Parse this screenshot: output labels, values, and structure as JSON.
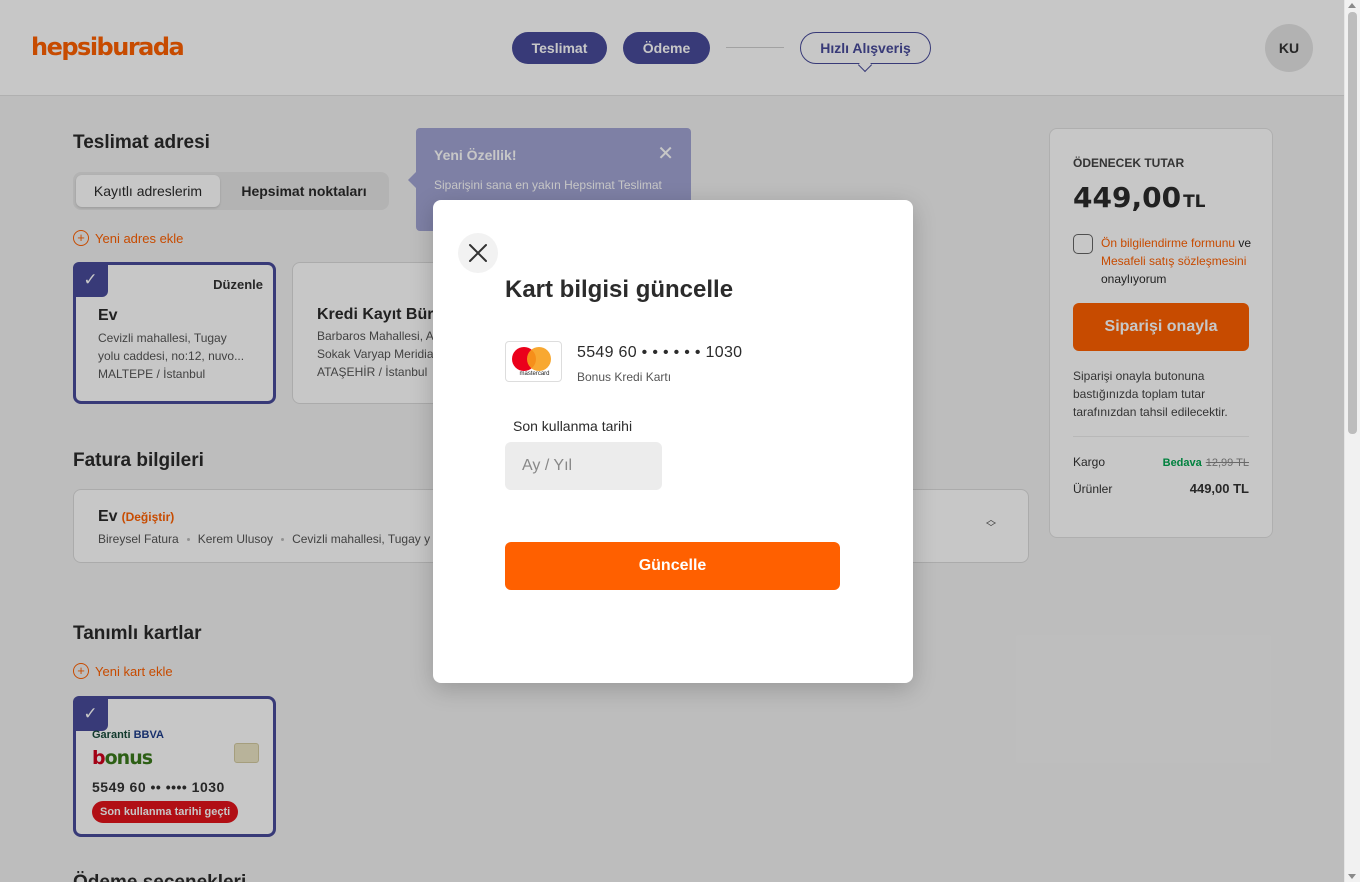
{
  "header": {
    "logo": "hepsiburada",
    "steps": [
      "Teslimat",
      "Ödeme",
      "Hızlı Alışveriş"
    ],
    "avatar_initials": "KU"
  },
  "delivery": {
    "title": "Teslimat adresi",
    "tabs": [
      "Kayıtlı adreslerim",
      "Hepsimat noktaları"
    ],
    "add_address": "Yeni adres ekle",
    "edit_label": "Düzenle",
    "addresses": [
      {
        "name": "Ev",
        "line1": "Cevizli mahallesi, Tugay",
        "line2": "yolu caddesi, no:12, nuvo...",
        "line3": "MALTEPE / İstanbul"
      },
      {
        "name": "Kredi Kayıt Büro",
        "line1": "Barbaros Mahallesi, A",
        "line2": "Sokak Varyap Meridia",
        "line3": "ATAŞEHİR / İstanbul"
      }
    ]
  },
  "tooltip": {
    "title": "Yeni Özellik!",
    "text": "Siparişini sana en yakın Hepsimat Teslimat noktasından teslim alabilirsin."
  },
  "billing": {
    "title": "Fatura bilgileri",
    "name": "Ev",
    "change": "(Değiştir)",
    "type": "Bireysel Fatura",
    "person": "Kerem Ulusoy",
    "address": "Cevizli mahallesi, Tugay y"
  },
  "cards": {
    "title": "Tanımlı kartlar",
    "add_card": "Yeni kart ekle",
    "bank_name": "Garanti",
    "bank_suffix": "BBVA",
    "brand": "bonus",
    "number": "5549 60 •• •••• 1030",
    "expired_badge": "Son kullanma tarihi geçti"
  },
  "bottom_title": "Ödeme seçenekleri",
  "summary": {
    "label": "ÖDENECEK TUTAR",
    "amount": "449,00",
    "currency": "TL",
    "link1": "Ön bilgilendirme formunu",
    "and": "ve",
    "link2": "Mesafeli satış sözleşmesini",
    "approve": "onaylıyorum",
    "confirm_button": "Siparişi onayla",
    "note": "Siparişi onayla butonuna bastığınızda toplam tutar tarafınızdan tahsil edilecektir.",
    "cargo_label": "Kargo",
    "cargo_free": "Bedava",
    "cargo_old": "12,99 TL",
    "products_label": "Ürünler",
    "products_price": "449,00 TL"
  },
  "modal": {
    "title": "Kart bilgisi güncelle",
    "card_logo_text": "mastercard",
    "card_number": "5549 60 • • • • • • 1030",
    "card_type": "Bonus Kredi Kartı",
    "expiry_label": "Son kullanma tarihi",
    "expiry_placeholder": "Ay / Yıl",
    "expiry_value": "",
    "update_button": "Güncelle"
  },
  "colors": {
    "brand_orange": "#ff6000",
    "accent_blue": "#484b9a",
    "error_red": "#e3141b"
  }
}
